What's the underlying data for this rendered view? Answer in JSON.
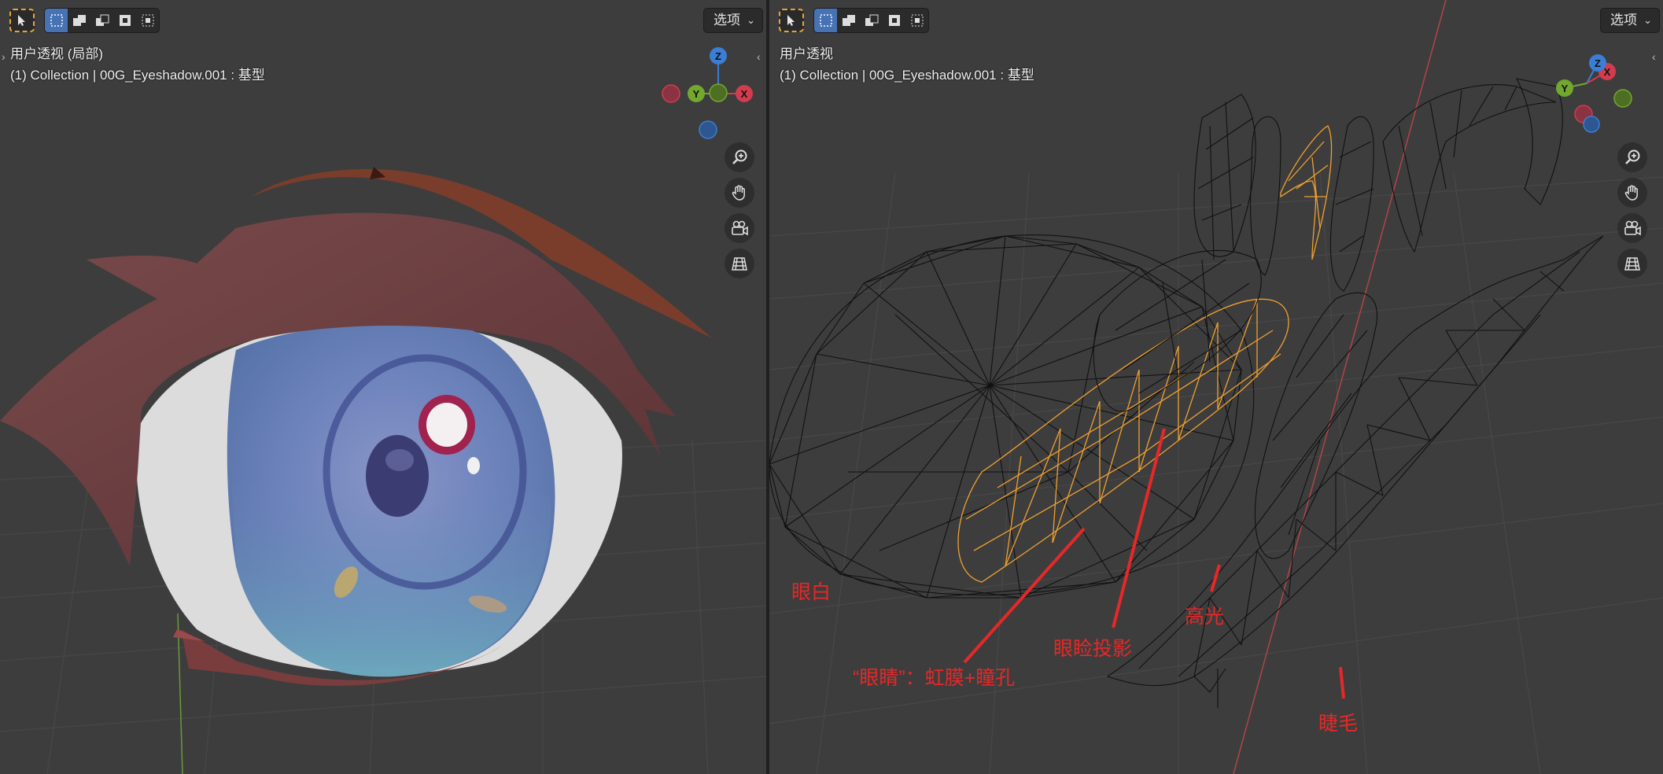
{
  "colors": {
    "viewport_bg": "#3d3d3d",
    "selection_orange": "#f0a030",
    "wire_black": "#101010",
    "annotation_red": "#e62828",
    "axis_x": "#d23c4e",
    "axis_y": "#72a82e",
    "axis_z": "#3a7ed6"
  },
  "left_viewport": {
    "view_name": "用户透视 (局部)",
    "object_info": "(1) Collection | 00G_Eyeshadow.001 : 基型",
    "options_label": "选项",
    "shading": "material-preview",
    "gizmo": {
      "x": "X",
      "y": "Y",
      "z": "Z"
    }
  },
  "right_viewport": {
    "view_name": "用户透视",
    "object_info": "(1) Collection | 00G_Eyeshadow.001 : 基型",
    "options_label": "选项",
    "shading": "wireframe",
    "gizmo": {
      "x": "X",
      "y": "Y",
      "z": "Z"
    },
    "annotations": {
      "eye_white": "眼白",
      "eye": "“眼睛”：虹膜+瞳孔",
      "eyelid_shadow": "眼睑投影",
      "highlight": "高光",
      "eyelash": "睫毛"
    }
  },
  "icons": {
    "select_tool": "cursor-arrow-icon",
    "mode_new": "select-new-icon",
    "mode_extend": "select-extend-icon",
    "mode_subtract": "select-subtract-icon",
    "mode_invert": "select-invert-icon",
    "mode_intersect": "select-intersect-icon",
    "zoom": "zoom-in-icon",
    "pan": "hand-icon",
    "camera": "camera-icon",
    "ortho": "grid-icon"
  }
}
